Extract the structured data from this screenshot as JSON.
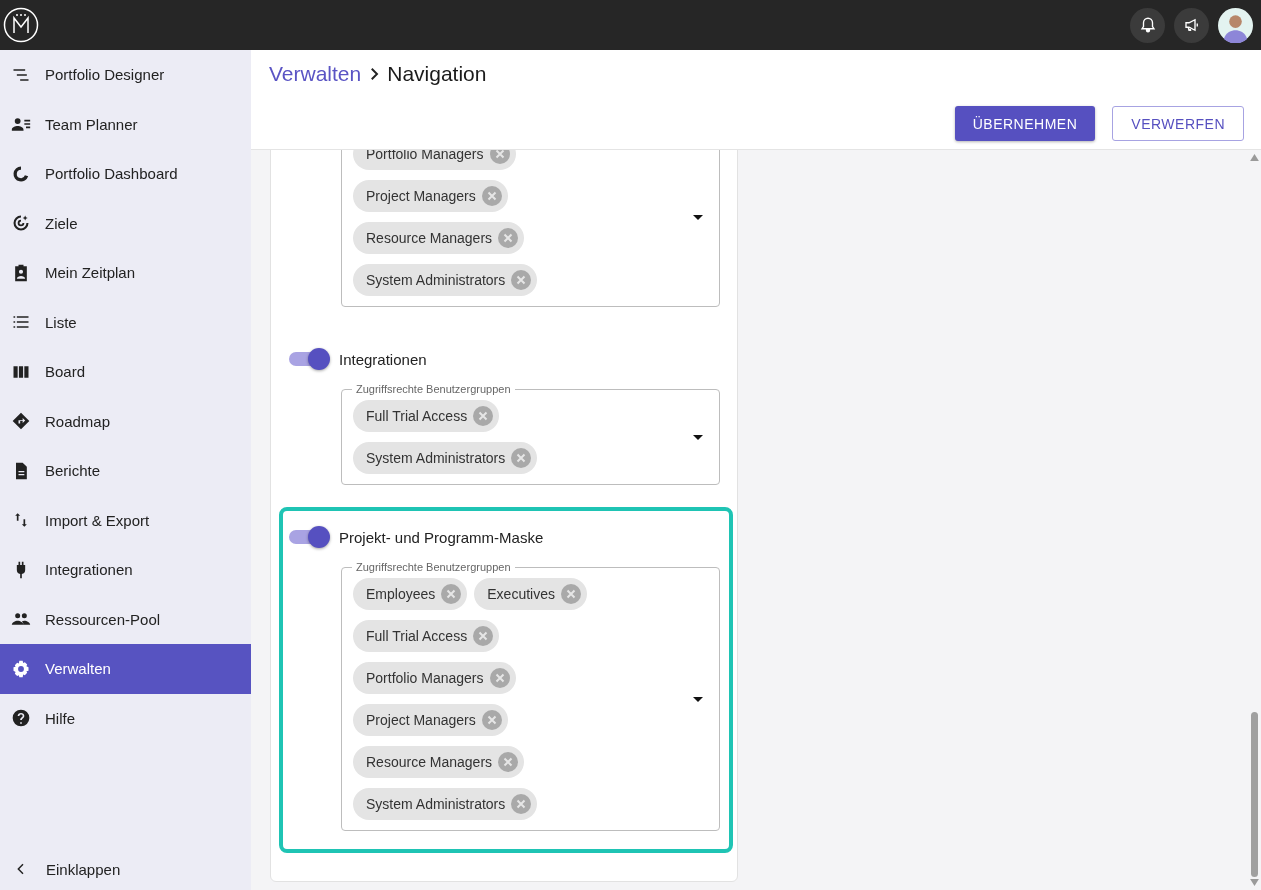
{
  "sidebar": {
    "items": [
      {
        "label": "Portfolio Designer",
        "selected": false
      },
      {
        "label": "Team Planner",
        "selected": false
      },
      {
        "label": "Portfolio Dashboard",
        "selected": false
      },
      {
        "label": "Ziele",
        "selected": false
      },
      {
        "label": "Mein Zeitplan",
        "selected": false
      },
      {
        "label": "Liste",
        "selected": false
      },
      {
        "label": "Board",
        "selected": false
      },
      {
        "label": "Roadmap",
        "selected": false
      },
      {
        "label": "Berichte",
        "selected": false
      },
      {
        "label": "Import & Export",
        "selected": false
      },
      {
        "label": "Integrationen",
        "selected": false
      },
      {
        "label": "Ressourcen-Pool",
        "selected": false
      },
      {
        "label": "Verwalten",
        "selected": true
      },
      {
        "label": "Hilfe",
        "selected": false
      }
    ],
    "collapse": "Einklappen"
  },
  "breadcrumb": {
    "parent": "Verwalten",
    "current": "Navigation"
  },
  "buttons": [
    {
      "label": "ÜBERNEHMEN",
      "kind": "primary"
    },
    {
      "label": "VERWERFEN",
      "kind": "outlined"
    }
  ],
  "sections": [
    {
      "highlighted": false,
      "chips": [
        "Portfolio Managers",
        "Project Managers",
        "Resource Managers",
        "System Administrators"
      ]
    },
    {
      "title": "Integrationen",
      "on": true,
      "highlighted": false,
      "field_label": "Zugriffsrechte Benutzergruppen",
      "chips": [
        "Full Trial Access",
        "System Administrators"
      ]
    },
    {
      "title": "Projekt- und Programm-Maske",
      "on": true,
      "highlighted": true,
      "field_label": "Zugriffsrechte Benutzergruppen",
      "chips": [
        "Employees",
        "Executives",
        "Full Trial Access",
        "Portfolio Managers",
        "Project Managers",
        "Resource Managers",
        "System Administrators"
      ]
    }
  ]
}
